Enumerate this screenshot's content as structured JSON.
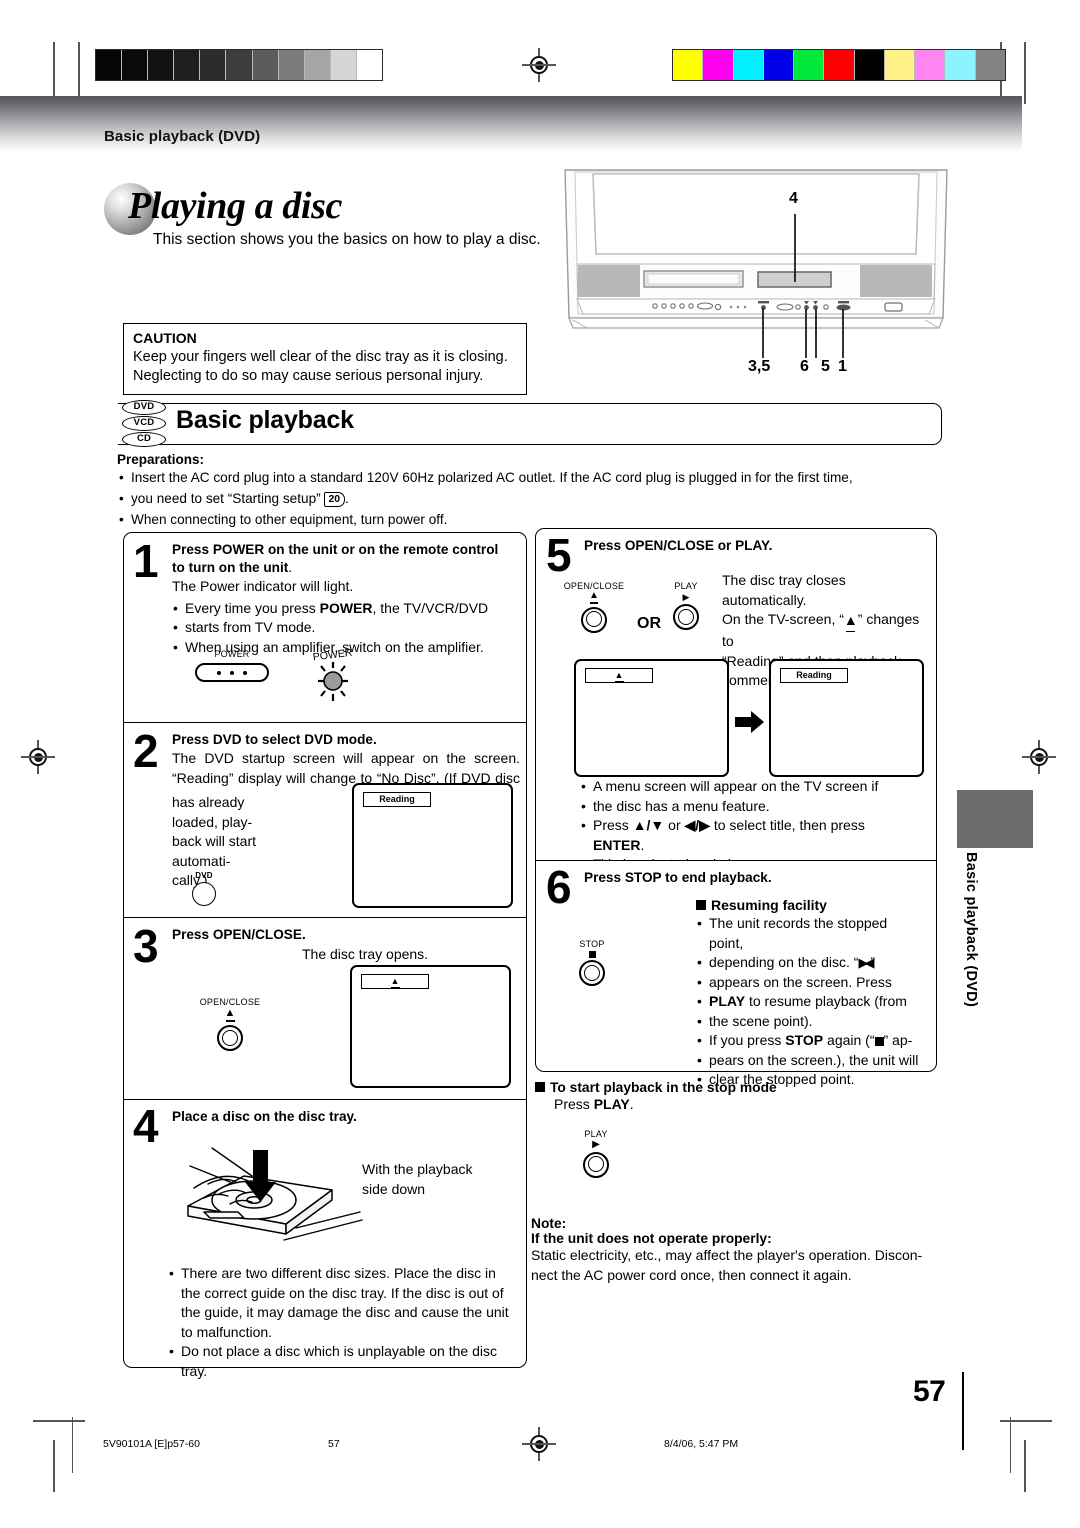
{
  "header": {
    "title": "Basic playback (DVD)"
  },
  "title": {
    "heading": "Playing a disc",
    "subtitle": "This section shows you the basics on how to play a disc."
  },
  "caution": {
    "label": "CAUTION",
    "line1": "Keep your fingers well clear of the disc tray as it is closing.",
    "line2": "Neglecting to do so may cause serious personal injury."
  },
  "section": {
    "heading": "Basic playback",
    "disc_icons": [
      "DVD",
      "VCD",
      "CD"
    ]
  },
  "preparations": {
    "label": "Preparations:",
    "bullet1_a": "Insert the AC cord plug into a standard 120V 60Hz polarized AC outlet. If the AC cord plug is plugged in for the first time,",
    "bullet1_b_pre": "you need to set “Starting setup”",
    "bullet1_ref": "20",
    "bullet1_b_post": ".",
    "bullet2": "When connecting to other equipment, turn power off."
  },
  "steps": [
    {
      "num": "1",
      "head_line1": "Press POWER on the unit or on the remote control",
      "head_line2": "to turn on the unit",
      "head_line2_tail": ".",
      "body": "The Power indicator will light.",
      "bullet1_a": "Every time you press ",
      "bullet1_b": "POWER",
      "bullet1_c": ", the TV/VCR/DVD",
      "bullet1_d": "starts from TV mode.",
      "bullet2": "When using an amplifier, switch on the amplifier.",
      "btn_power_label": "POWER",
      "indicator_label": "POWER"
    },
    {
      "num": "2",
      "head": "Press DVD to select DVD mode.",
      "body_line1": "The DVD startup screen will appear on the screen.",
      "body_line2": "“Reading” display will change to “No Disc”. (If DVD disc",
      "body_line3": "has already loaded, play-",
      "body_line4": "back will start automati-",
      "body_line5": "cally.)",
      "btn_label": "DVD",
      "osd": "Reading"
    },
    {
      "num": "3",
      "head": "Press OPEN/CLOSE.",
      "body": "The disc tray opens.",
      "btn_label": "OPEN/CLOSE",
      "btn_glyph": "⏏",
      "osd": "⏏"
    },
    {
      "num": "4",
      "head": "Place a disc on the disc tray.",
      "caption_line1": "With the playback",
      "caption_line2": "side down",
      "bullet1": "There are two different disc sizes. Place the disc in the correct guide on the disc tray. If the disc is out of the guide, it may damage the disc and cause the unit to malfunction.",
      "bullet2": "Do not place a disc which is unplayable on the disc tray."
    },
    {
      "num": "5",
      "head": "Press OPEN/CLOSE or PLAY.",
      "body_line1": "The disc tray closes automatically.",
      "body_line2_a": "On the TV-screen, “",
      "body_line2_glyph": "⏏",
      "body_line2_b": "” changes to",
      "body_line3": "“Reading” and then playback",
      "body_line4": "commences.",
      "btn_left_label": "OPEN/CLOSE",
      "btn_left_glyph": "⏏",
      "or_label": "OR",
      "btn_right_label": "PLAY",
      "btn_right_glyph": "▶",
      "osd_left": "⏏",
      "osd_right": "Reading",
      "bullet_line1": "A menu screen will appear on the TV screen if",
      "bullet_line2": "the disc has a menu feature.",
      "bullet_line3_a": "Press ",
      "bullet_line3_arrows1": "▲/▼",
      "bullet_line3_b": " or ",
      "bullet_line3_arrows2": "◀/▶",
      "bullet_line3_c": " to select title, then press ",
      "bullet_line3_d": "ENTER",
      "bullet_line3_e": ".",
      "bullet_line4": "Title is selected and play commences."
    },
    {
      "num": "6",
      "head": "Press STOP to end playback.",
      "sub_head": "Resuming facility",
      "btn_label": "STOP",
      "b1_l1": "The unit records the stopped point,",
      "b1_l2_a": "depending on the disc. “",
      "b1_l2_glyph": "▶◀",
      "b1_l2_b": "”",
      "b1_l3": "appears on the screen. Press",
      "b1_l4_a": "PLAY",
      "b1_l4_b": " to resume playback (from",
      "b1_l5": "the scene point).",
      "b2_l1_a": "If you press ",
      "b2_l1_b": "STOP",
      "b2_l1_c": " again (“",
      "b2_l1_glyph": "■",
      "b2_l1_d": "” ap-",
      "b2_l2": "pears on the screen.), the unit will",
      "b2_l3": "clear the stopped point."
    }
  ],
  "stop_mode": {
    "heading": "To start playback in the stop mode",
    "line_a": "Press ",
    "line_b": "PLAY",
    "line_c": ".",
    "btn_label": "PLAY",
    "btn_glyph": "▶"
  },
  "note": {
    "label": "Note:",
    "heading": "If the unit does not operate properly:",
    "line1": "Static electricity, etc., may affect the player's operation. Discon-",
    "line2": "nect the AC power cord once, then connect it again."
  },
  "device_callouts": {
    "top": "4",
    "bottom": [
      "3,5",
      "6",
      "5",
      "1"
    ]
  },
  "side_tab": {
    "label": "Basic playback (DVD)"
  },
  "page_number": "57",
  "footer": {
    "file_id": "5V90101A [E]p57-60",
    "page": "57",
    "timestamp": "8/4/06, 5:47 PM"
  },
  "colors": {
    "grayscale_bar": [
      "#050505",
      "#0a0a0a",
      "#121212",
      "#1e1e1e",
      "#2c2c2c",
      "#3d3d3d",
      "#5b5b5b",
      "#7c7c7c",
      "#a6a6a6",
      "#d6d6d6",
      "#ffffff"
    ],
    "color_bar": [
      "#ffff00",
      "#ff00ee",
      "#00f0ff",
      "#0000e8",
      "#00e83c",
      "#ff0000",
      "#000000",
      "#fff185",
      "#ff86f2",
      "#8bf4ff",
      "#838383"
    ]
  }
}
